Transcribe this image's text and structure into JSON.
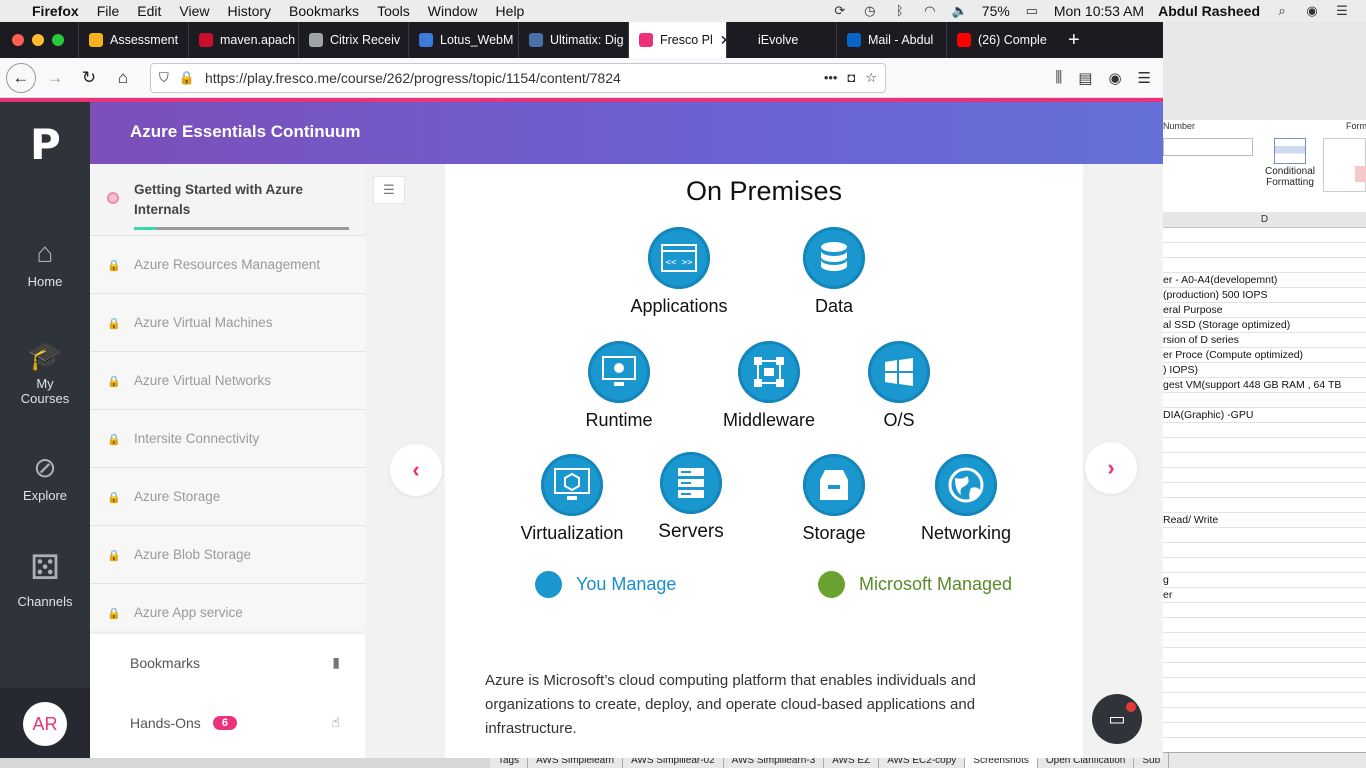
{
  "menubar": {
    "app": "Firefox",
    "items": [
      "File",
      "Edit",
      "View",
      "History",
      "Bookmarks",
      "Tools",
      "Window",
      "Help"
    ],
    "battery": "75%",
    "clock": "Mon 10:53 AM",
    "user": "Abdul Rasheed"
  },
  "browser": {
    "tabs": [
      {
        "label": "Assessment",
        "color": "#f6b21a"
      },
      {
        "label": "maven.apach",
        "color": "#c8102e"
      },
      {
        "label": "Citrix Receiv",
        "color": "#9ea3a8"
      },
      {
        "label": "Lotus_WebM",
        "color": "#3d7bd8"
      },
      {
        "label": "Ultimatix: Dig",
        "color": "#4a6fa5"
      },
      {
        "label": "Fresco Pl",
        "color": "#e9327a",
        "active": true
      },
      {
        "label": "iEvolve",
        "color": "#1c1b22"
      },
      {
        "label": "Mail - Abdul",
        "color": "#0a64c8"
      },
      {
        "label": "(26) Comple",
        "color": "#ff0000"
      }
    ],
    "url": "https://play.fresco.me/course/262/progress/topic/1154/content/7824"
  },
  "rail": {
    "logo": "P",
    "items": [
      {
        "label": "Home",
        "icon": "home-icon"
      },
      {
        "label": "My Courses",
        "icon": "graduation-cap-icon"
      },
      {
        "label": "Explore",
        "icon": "compass-icon"
      },
      {
        "label": "Channels",
        "icon": "dice-icon"
      }
    ],
    "avatar": "AR"
  },
  "course": {
    "title": "Azure Essentials Continuum",
    "current_topic": "Getting Started with Azure Internals",
    "current_progress": 0.1,
    "topics": [
      "Azure Resources Management",
      "Azure Virtual Machines",
      "Azure Virtual Networks",
      "Intersite Connectivity",
      "Azure Storage",
      "Azure Blob Storage",
      "Azure App service"
    ],
    "footer": {
      "bookmarks": "Bookmarks",
      "handson": "Hands-Ons",
      "handson_count": "6"
    }
  },
  "content": {
    "diagram_title": "On Premises",
    "items": [
      {
        "label": "Applications",
        "icon": "code-window-icon"
      },
      {
        "label": "Data",
        "icon": "database-icon"
      },
      {
        "label": "Runtime",
        "icon": "monitor-gear-icon"
      },
      {
        "label": "Middleware",
        "icon": "network-nodes-icon"
      },
      {
        "label": "O/S",
        "icon": "windows-icon"
      },
      {
        "label": "Virtualization",
        "icon": "cube-monitor-icon"
      },
      {
        "label": "Servers",
        "icon": "server-rack-icon"
      },
      {
        "label": "Storage",
        "icon": "storage-drive-icon"
      },
      {
        "label": "Networking",
        "icon": "globe-icon"
      }
    ],
    "legend": [
      {
        "label": "You Manage",
        "color": "#1a97cf"
      },
      {
        "label": "Microsoft Managed",
        "color": "#6aa232"
      }
    ],
    "paragraph": "Azure is Microsoft’s cloud computing platform that enables individuals and organizations to create, deploy, and operate cloud-based applications and infrastructure."
  },
  "excel": {
    "number_label": "Number",
    "format_label": "Form",
    "cf_label": "Conditional Formatting",
    "col_d": "D",
    "rows": [
      "",
      "",
      "",
      "er - A0-A4(developemnt)",
      "(production) 500 IOPS",
      "eral Purpose",
      "al SSD (Storage optimized)",
      "rsion of D series",
      "er Proce (Compute optimized)",
      ") IOPS)",
      "gest VM(support 448 GB RAM , 64 TB",
      "",
      "DIA(Graphic) -GPU",
      "",
      "",
      "",
      "",
      "",
      "",
      "Read/ Write",
      "",
      "",
      "",
      "g",
      "er",
      "",
      "",
      "",
      "",
      "",
      "",
      "",
      "",
      "",
      "",
      ""
    ],
    "sheet_tabs": [
      "Tags",
      "AWS Simplelearn",
      "AWS Simplilear-02",
      "AWS Simplilearn-3",
      "AWS EZ",
      "AWS EC2-copy",
      "Screenshots",
      "Open Clarification",
      "Sub"
    ]
  }
}
